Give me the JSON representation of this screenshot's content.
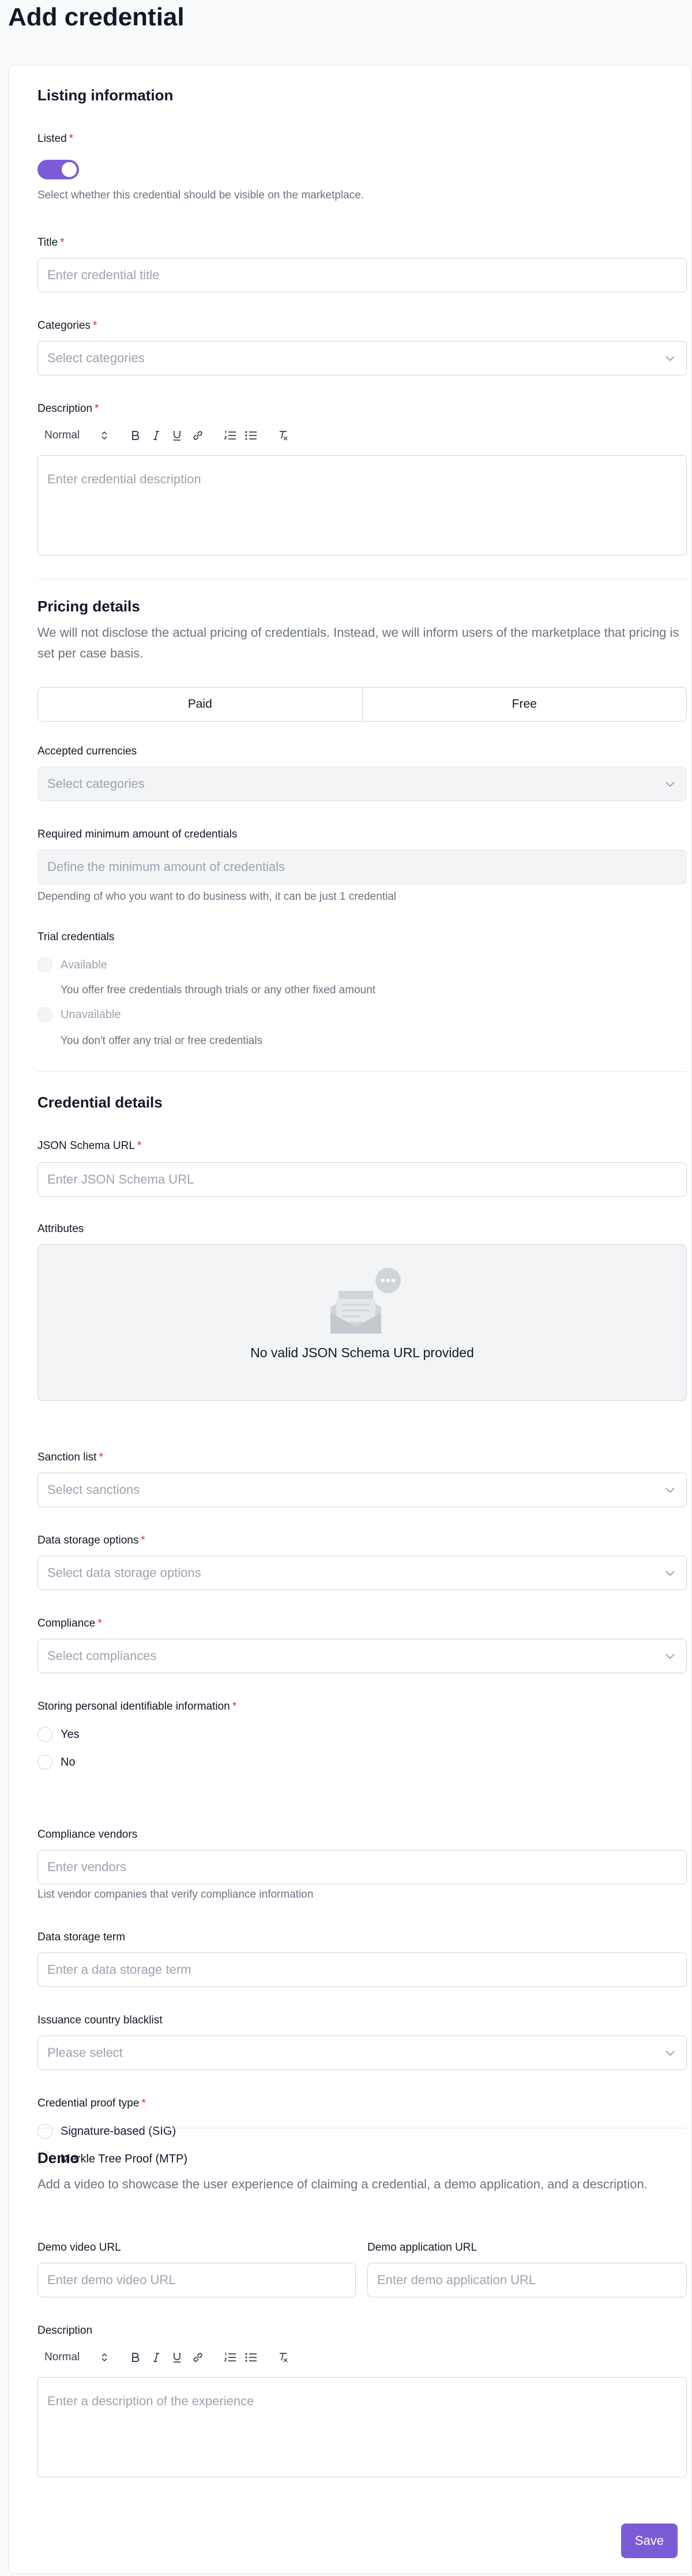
{
  "page": {
    "title": "Add credential"
  },
  "listing": {
    "title": "Listing information",
    "listed_label": "Listed",
    "listed_help": "Select whether this credential should be visible on the marketplace.",
    "listed_on": true,
    "title_label": "Title",
    "title_placeholder": "Enter credential title",
    "categories_label": "Categories",
    "categories_placeholder": "Select categories",
    "description_label": "Description",
    "description_placeholder": "Enter credential description"
  },
  "toolbar": {
    "style_value": "Normal",
    "icons": [
      "bold-icon",
      "italic-icon",
      "underline-icon",
      "link-icon",
      "ordered-list-icon",
      "bullet-list-icon",
      "clear-format-icon"
    ]
  },
  "pricing": {
    "title": "Pricing details",
    "description": "We will not disclose the actual pricing of credentials. Instead, we will inform users of the marketplace that pricing is set per case basis.",
    "options": [
      "Paid",
      "Free"
    ],
    "currencies_label": "Accepted currencies",
    "currencies_placeholder": "Select categories",
    "minimum_label": "Required minimum amount of credentials",
    "minimum_placeholder": "Define the minimum amount of credentials",
    "minimum_help": "Depending of who you want to do business with, it can be just 1 credential",
    "trial_label": "Trial credentials",
    "trial_available": "Available",
    "trial_available_help": "You offer free credentials through trials or any other fixed amount",
    "trial_unavailable": "Unavailable",
    "trial_unavailable_help": "You don't offer any trial or free credentials"
  },
  "credential": {
    "title": "Credential details",
    "schema_label": "JSON Schema URL",
    "schema_placeholder": "Enter JSON Schema URL",
    "attributes_label": "Attributes",
    "attributes_empty": "No valid JSON Schema URL provided",
    "sanction_label": "Sanction list",
    "sanction_placeholder": "Select sanctions",
    "storage_label": "Data storage options",
    "storage_placeholder": "Select data storage options",
    "compliance_label": "Compliance",
    "compliance_placeholder": "Select compliances",
    "pii_label": "Storing personal identifiable information",
    "pii_yes": "Yes",
    "pii_no": "No",
    "vendors_label": "Compliance vendors",
    "vendors_placeholder": "Enter vendors",
    "vendors_help": "List vendor companies that verify compliance information",
    "term_label": "Data storage term",
    "term_placeholder": "Enter a data storage term",
    "blacklist_label": "Issuance country blacklist",
    "blacklist_placeholder": "Please select",
    "proof_label": "Credential proof type",
    "proof_sig": "Signature-based (SIG)",
    "proof_mtp": "Merkle Tree Proof (MTP)"
  },
  "demo": {
    "title": "Demo",
    "description": "Add a video to showcase the user experience of claiming a credential, a demo application, and a description.",
    "video_label": "Demo video URL",
    "video_placeholder": "Enter demo video URL",
    "app_label": "Demo application URL",
    "app_placeholder": "Enter demo application URL",
    "desc_label": "Description",
    "desc_placeholder": "Enter a description of the experience"
  },
  "actions": {
    "save_label": "Save"
  },
  "colors": {
    "accent": "#7c5cd6",
    "required": "#e11d48",
    "muted": "#6b7280",
    "placeholder": "#9ca3af"
  }
}
